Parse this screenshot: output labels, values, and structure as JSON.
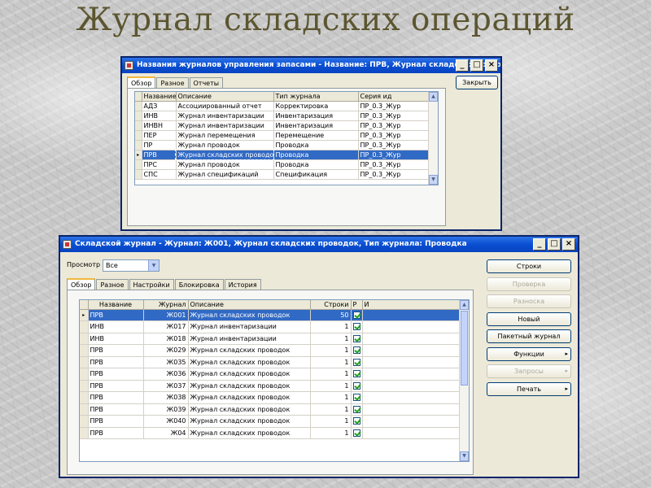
{
  "slide": {
    "title": "Журнал складских операций"
  },
  "window1": {
    "title": "Названия журналов управления запасами - Название: ПРВ, Журнал складских проводок",
    "tabs": [
      "Обзор",
      "Разное",
      "Отчеты"
    ],
    "close_button": "Закрыть",
    "columns": [
      "Название",
      "Описание",
      "Тип журнала",
      "Серия ид"
    ],
    "rows": [
      {
        "name": "АДЗ",
        "desc": "Ассоциированный отчет",
        "type": "Корректировка",
        "series": "ПР_0.3_Жур"
      },
      {
        "name": "ИНВ",
        "desc": "Журнал инвентаризации",
        "type": "Инвентаризация",
        "series": "ПР_0.3_Жур"
      },
      {
        "name": "ИНВН",
        "desc": "Журнал инвентаризации",
        "type": "Инвентаризация",
        "series": "ПР_0.3_Жур"
      },
      {
        "name": "ПЕР",
        "desc": "Журнал перемещения",
        "type": "Перемещение",
        "series": "ПР_0.3_Жур"
      },
      {
        "name": "ПР",
        "desc": "Журнал проводок",
        "type": "Проводка",
        "series": "ПР_0.3_Жур"
      },
      {
        "name": "ПРВ",
        "desc": "Журнал складских проводок",
        "type": "Проводка",
        "series": "ПР_0.3_Жур"
      },
      {
        "name": "ПРС",
        "desc": "Журнал проводок",
        "type": "Проводка",
        "series": "ПР_0.3_Жур"
      },
      {
        "name": "СПС",
        "desc": "Журнал спецификаций",
        "type": "Спецификация",
        "series": "ПР_0.3_Жур"
      }
    ],
    "selected_row": 5
  },
  "window2": {
    "title": "Складской журнал - Журнал: Ж001, Журнал складских проводок, Тип журнала: Проводка",
    "filter_label": "Просмотр",
    "filter_value": "Все",
    "tabs": [
      "Обзор",
      "Разное",
      "Настройки",
      "Блокировка",
      "История"
    ],
    "columns": [
      "Название",
      "Журнал",
      "Описание",
      "Строки",
      "Р",
      "И"
    ],
    "rows": [
      {
        "name": "ПРВ",
        "journal": "Ж001",
        "desc": "Журнал складских проводок",
        "lines": "50",
        "p": true,
        "i": false
      },
      {
        "name": "ИНВ",
        "journal": "Ж017",
        "desc": "Журнал инвентаризации",
        "lines": "1",
        "p": true,
        "i": false
      },
      {
        "name": "ИНВ",
        "journal": "Ж018",
        "desc": "Журнал инвентаризации",
        "lines": "1",
        "p": true,
        "i": false
      },
      {
        "name": "ПРВ",
        "journal": "Ж029",
        "desc": "Журнал складских проводок",
        "lines": "1",
        "p": true,
        "i": false
      },
      {
        "name": "ПРВ",
        "journal": "Ж035",
        "desc": "Журнал складских проводок",
        "lines": "1",
        "p": true,
        "i": false
      },
      {
        "name": "ПРВ",
        "journal": "Ж036",
        "desc": "Журнал складских проводок",
        "lines": "1",
        "p": true,
        "i": false
      },
      {
        "name": "ПРВ",
        "journal": "Ж037",
        "desc": "Журнал складских проводок",
        "lines": "1",
        "p": true,
        "i": false
      },
      {
        "name": "ПРВ",
        "journal": "Ж038",
        "desc": "Журнал складских проводок",
        "lines": "1",
        "p": true,
        "i": false
      },
      {
        "name": "ПРВ",
        "journal": "Ж039",
        "desc": "Журнал складских проводок",
        "lines": "1",
        "p": true,
        "i": false
      },
      {
        "name": "ПРВ",
        "journal": "Ж040",
        "desc": "Журнал складских проводок",
        "lines": "1",
        "p": true,
        "i": false
      },
      {
        "name": "ПРВ",
        "journal": "Ж04",
        "desc": "Журнал складских проводок",
        "lines": "1",
        "p": true,
        "i": false
      }
    ],
    "selected_row": 0,
    "buttons": [
      {
        "label": "Строки",
        "enabled": true,
        "menu": false
      },
      {
        "label": "Проверка",
        "enabled": false,
        "menu": false
      },
      {
        "label": "Разноска",
        "enabled": false,
        "menu": false
      },
      {
        "label": "Новый",
        "enabled": true,
        "menu": false
      },
      {
        "label": "Пакетный журнал",
        "enabled": true,
        "menu": false
      },
      {
        "label": "Функции",
        "enabled": true,
        "menu": true
      },
      {
        "label": "Запросы",
        "enabled": false,
        "menu": true
      },
      {
        "label": "Печать",
        "enabled": true,
        "menu": true
      }
    ]
  }
}
